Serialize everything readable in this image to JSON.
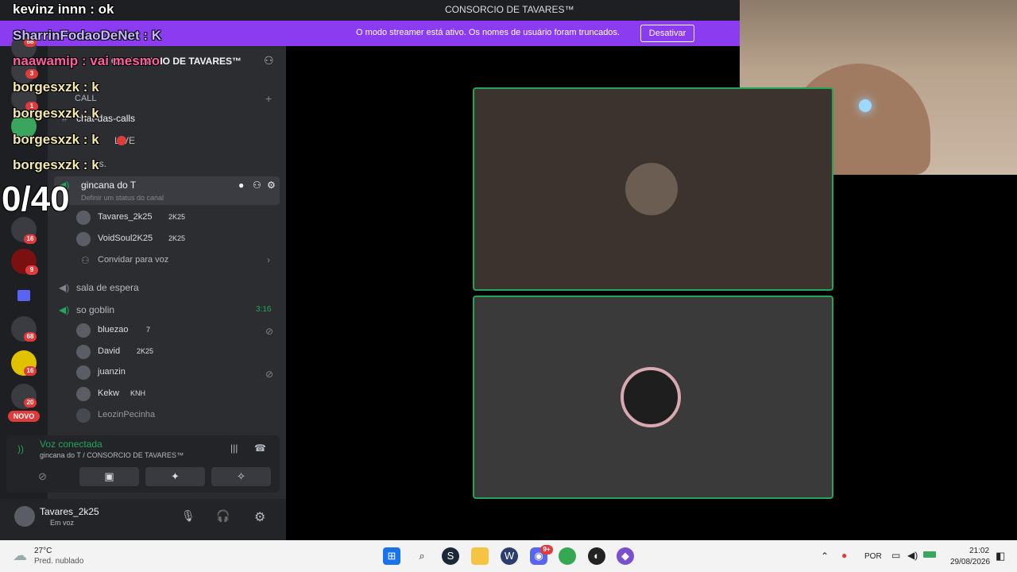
{
  "window": {
    "title": "CONSORCIO DE TAVARES™"
  },
  "banner": {
    "text": "O modo streamer está ativo. Os nomes de usuário foram truncados.",
    "button": "Desativar"
  },
  "overlay": {
    "lines": [
      "kevinz innn : ok",
      "SharrinFodaoDeNet : K",
      "naawamip : vai mesmo",
      "borgesxzk : k",
      "borgesxzk : k",
      "borgesxzk : k",
      "borgesxzk : k"
    ],
    "counter": "0/40"
  },
  "server_rail": {
    "badges": [
      "68",
      "3",
      "1",
      "16",
      "9",
      "68",
      "16",
      "20"
    ],
    "novo": "NOVO"
  },
  "sidebar": {
    "server_name": "CONSORCIO DE TAVARES™",
    "category": "CALL",
    "text_channel": "chat-das-calls",
    "live_channel": "LIVE",
    "other_channel": "es.",
    "voice_channel_active": "gincana do T",
    "status_placeholder": "Definir um status do canal",
    "active_users": [
      {
        "name": "Tavares_2k25",
        "tag": "2K25"
      },
      {
        "name": "VoidSoul2K25",
        "tag": "2K25"
      }
    ],
    "invite": "Convidar para voz",
    "waiting_room": "sala de espera",
    "goblin_channel": "so goblin",
    "goblin_time": "3:16",
    "goblin_users": [
      {
        "name": "bluezao",
        "tag": "7"
      },
      {
        "name": "David",
        "tag": "2K25"
      },
      {
        "name": "juanzin",
        "tag": ""
      },
      {
        "name": "Kekw",
        "tag": "KNH"
      },
      {
        "name": "LeozinPecinha",
        "tag": ""
      }
    ]
  },
  "voice_panel": {
    "status": "Voz conectada",
    "location": "gincana do T / CONSORCIO DE TAVARES™"
  },
  "userbar": {
    "username": "Tavares_2k25",
    "status": "Em voz"
  },
  "taskbar": {
    "weather_temp": "27°C",
    "weather_desc": "Pred. nublado",
    "lang": "POR",
    "time": "21:02",
    "date": "29/08/2026",
    "discord_badge": "9+"
  },
  "colors": {
    "accent": "#8b3bf0",
    "voice_green": "#23a55a",
    "badge_red": "#e03b3b"
  }
}
